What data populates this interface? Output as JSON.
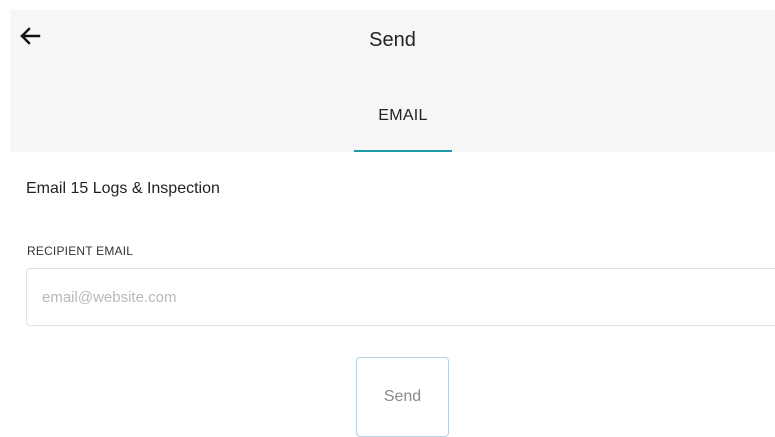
{
  "header": {
    "back_icon": "arrow-left-icon",
    "title": "Send"
  },
  "tabs": [
    {
      "label": "EMAIL",
      "active": true
    }
  ],
  "main": {
    "title": "Email 15 Logs & Inspection",
    "recipient_label": "RECIPIENT EMAIL",
    "email_value": "",
    "email_placeholder": "email@website.com",
    "send_label": "Send"
  },
  "colors": {
    "header_bg": "#f6f6f6",
    "tab_indicator": "#1a9da6",
    "button_border": "#b7d3e3"
  }
}
